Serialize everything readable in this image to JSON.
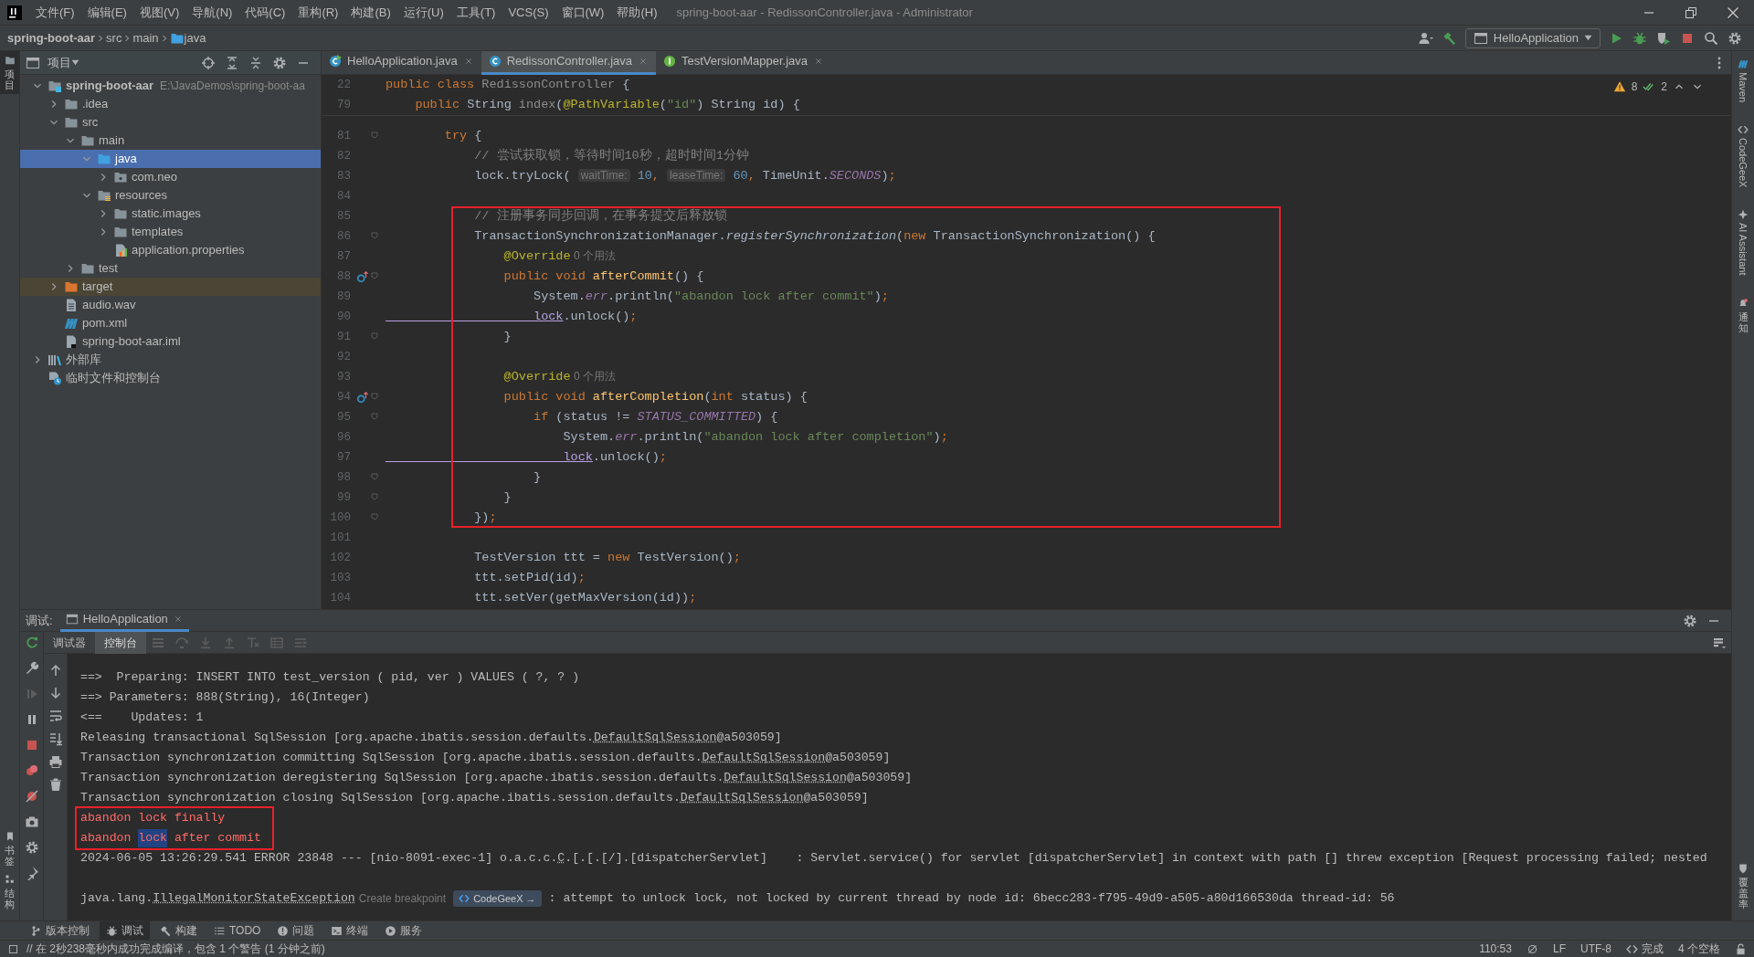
{
  "window": {
    "title": "spring-boot-aar - RedissonController.java - Administrator",
    "menu": [
      "文件(F)",
      "编辑(E)",
      "视图(V)",
      "导航(N)",
      "代码(C)",
      "重构(R)",
      "构建(B)",
      "运行(U)",
      "工具(T)",
      "VCS(S)",
      "窗口(W)",
      "帮助(H)"
    ]
  },
  "breadcrumbs": [
    {
      "label": "spring-boot-aar",
      "kind": "project"
    },
    {
      "label": "src",
      "kind": "dir"
    },
    {
      "label": "main",
      "kind": "dir"
    },
    {
      "label": "java",
      "kind": "source"
    }
  ],
  "run_config": {
    "label": "HelloApplication"
  },
  "left_stripe": {
    "top": [
      {
        "label": "项目",
        "selected": true
      }
    ],
    "bottom": [
      {
        "label": "书签",
        "selected": false
      },
      {
        "label": "结构",
        "selected": false
      }
    ]
  },
  "right_stripe": {
    "top": [
      {
        "label": "Maven",
        "kind": "maven"
      },
      {
        "label": "CodeGeeX",
        "kind": "codegeex"
      },
      {
        "label": "AI Assistant",
        "kind": "ai"
      },
      {
        "label": "通知",
        "kind": "bell"
      }
    ],
    "bottom": [
      {
        "label": "覆盖率",
        "kind": "shield"
      }
    ]
  },
  "project_panel": {
    "title": "项目",
    "tree": [
      {
        "label": "spring-boot-aar",
        "note": "E:\\JavaDemos\\spring-boot-aa",
        "kind": "module",
        "expanded": true,
        "selected": false,
        "children": [
          {
            "label": ".idea",
            "kind": "folder",
            "expanded": false,
            "selected": false
          },
          {
            "label": "src",
            "kind": "folder",
            "expanded": true,
            "selected": false,
            "children": [
              {
                "label": "main",
                "kind": "folder",
                "expanded": true,
                "selected": false,
                "children": [
                  {
                    "label": "java",
                    "kind": "source",
                    "expanded": true,
                    "selected": true,
                    "children": [
                      {
                        "label": "com.neo",
                        "kind": "package",
                        "expanded": false,
                        "selected": false
                      }
                    ]
                  },
                  {
                    "label": "resources",
                    "kind": "resources",
                    "expanded": true,
                    "selected": false,
                    "children": [
                      {
                        "label": "static.images",
                        "kind": "folder",
                        "expanded": false,
                        "selected": false
                      },
                      {
                        "label": "templates",
                        "kind": "folder",
                        "expanded": false,
                        "selected": false
                      },
                      {
                        "label": "application.properties",
                        "kind": "props",
                        "selected": false
                      }
                    ]
                  }
                ]
              },
              {
                "label": "test",
                "kind": "folder",
                "expanded": false,
                "selected": false
              }
            ]
          },
          {
            "label": "target",
            "kind": "excluded",
            "expanded": false,
            "selected": false
          },
          {
            "label": "audio.wav",
            "kind": "doc",
            "selected": false
          },
          {
            "label": "pom.xml",
            "kind": "maven",
            "selected": false
          },
          {
            "label": "spring-boot-aar.iml",
            "kind": "iml",
            "selected": false
          }
        ]
      },
      {
        "label": "外部库",
        "kind": "libs",
        "expanded": false,
        "selected": false
      },
      {
        "label": "临时文件和控制台",
        "kind": "scratch",
        "selected": false
      }
    ]
  },
  "editor": {
    "tabs": [
      {
        "label": "HelloApplication.java",
        "kind": "runnable",
        "selected": false
      },
      {
        "label": "RedissonController.java",
        "kind": "class",
        "selected": true
      },
      {
        "label": "TestVersionMapper.java",
        "kind": "interface",
        "selected": false
      }
    ],
    "inspections": {
      "warnings": "8",
      "checks": "2"
    },
    "sticky_lines": [
      {
        "number": "22",
        "tokens": [
          {
            "text": "public class ",
            "kind": "kw"
          },
          {
            "text": "RedissonController",
            "kind": "dim"
          },
          {
            "text": " {",
            "kind": "plain"
          }
        ]
      },
      {
        "number": "79",
        "tokens": [
          {
            "text": "    public ",
            "kind": "kw"
          },
          {
            "text": "String ",
            "kind": "plain"
          },
          {
            "text": "index",
            "kind": "dim"
          },
          {
            "text": "(",
            "kind": "plain"
          },
          {
            "text": "@PathVariable",
            "kind": "anno"
          },
          {
            "text": "(",
            "kind": "plain"
          },
          {
            "text": "\"id\"",
            "kind": "str"
          },
          {
            "text": ") String id) {",
            "kind": "plain"
          }
        ]
      }
    ],
    "lines": [
      {
        "number": "81",
        "fold": true,
        "override": false,
        "boxed": false,
        "tokens": [
          {
            "text": "        try",
            "kind": "kw"
          },
          {
            "text": " {",
            "kind": "plain"
          }
        ]
      },
      {
        "number": "82",
        "fold": false,
        "override": false,
        "boxed": false,
        "tokens": [
          {
            "text": "            // 尝试获取锁，等待时间10秒，超时时间1分钟",
            "kind": "cmt"
          }
        ]
      },
      {
        "number": "83",
        "fold": false,
        "override": false,
        "boxed": false,
        "tokens": [
          {
            "text": "            lock.tryLock( ",
            "kind": "plain"
          },
          {
            "text": "waitTime:",
            "kind": "hint"
          },
          {
            "text": " 10",
            "kind": "num"
          },
          {
            "text": ", ",
            "kind": "kw"
          },
          {
            "text": "leaseTime:",
            "kind": "hint"
          },
          {
            "text": " 60",
            "kind": "num"
          },
          {
            "text": ", ",
            "kind": "kw"
          },
          {
            "text": "TimeUnit.",
            "kind": "plain"
          },
          {
            "text": "SECONDS",
            "kind": "const"
          },
          {
            "text": ")",
            "kind": "plain"
          },
          {
            "text": ";",
            "kind": "kw"
          }
        ]
      },
      {
        "number": "84",
        "fold": false,
        "override": false,
        "boxed": false
      },
      {
        "number": "85",
        "fold": false,
        "override": false,
        "boxed": true,
        "tokens": [
          {
            "text": "            // 注册事务同步回调，在事务提交后释放锁",
            "kind": "cmt"
          }
        ]
      },
      {
        "number": "86",
        "fold": true,
        "override": false,
        "boxed": true,
        "tokens": [
          {
            "text": "            TransactionSynchronizationManager.",
            "kind": "plain"
          },
          {
            "text": "registerSynchronization",
            "kind": "it"
          },
          {
            "text": "(",
            "kind": "plain"
          },
          {
            "text": "new ",
            "kind": "kw"
          },
          {
            "text": "TransactionSynchronization() {",
            "kind": "plain"
          }
        ]
      },
      {
        "number": "87",
        "fold": false,
        "override": false,
        "boxed": true,
        "tokens": [
          {
            "text": "                @Override",
            "kind": "anno"
          },
          {
            "text": " 0 个用法",
            "kind": "usage"
          }
        ]
      },
      {
        "number": "88",
        "fold": true,
        "override": true,
        "boxed": true,
        "tokens": [
          {
            "text": "                public void ",
            "kind": "kw"
          },
          {
            "text": "afterCommit",
            "kind": "fn"
          },
          {
            "text": "() {",
            "kind": "plain"
          }
        ]
      },
      {
        "number": "89",
        "fold": false,
        "override": false,
        "boxed": true,
        "tokens": [
          {
            "text": "                    System.",
            "kind": "plain"
          },
          {
            "text": "err",
            "kind": "const"
          },
          {
            "text": ".println(",
            "kind": "plain"
          },
          {
            "text": "\"abandon lock after commit\"",
            "kind": "str"
          },
          {
            "text": ")",
            "kind": "plain"
          },
          {
            "text": ";",
            "kind": "kw"
          }
        ]
      },
      {
        "number": "90",
        "fold": false,
        "override": false,
        "boxed": true,
        "tokens": [
          {
            "text": "                    lock",
            "kind": "var"
          },
          {
            "text": ".unlock()",
            "kind": "plain"
          },
          {
            "text": ";",
            "kind": "kw"
          }
        ]
      },
      {
        "number": "91",
        "fold": true,
        "override": false,
        "boxed": true,
        "tokens": [
          {
            "text": "                }",
            "kind": "plain"
          }
        ]
      },
      {
        "number": "92",
        "fold": false,
        "override": false,
        "boxed": true
      },
      {
        "number": "93",
        "fold": false,
        "override": false,
        "boxed": true,
        "tokens": [
          {
            "text": "                @Override",
            "kind": "anno"
          },
          {
            "text": " 0 个用法",
            "kind": "usage"
          }
        ]
      },
      {
        "number": "94",
        "fold": true,
        "override": true,
        "boxed": true,
        "tokens": [
          {
            "text": "                public void ",
            "kind": "kw"
          },
          {
            "text": "afterCompletion",
            "kind": "fn"
          },
          {
            "text": "(",
            "kind": "plain"
          },
          {
            "text": "int ",
            "kind": "kw"
          },
          {
            "text": "status) {",
            "kind": "plain"
          }
        ]
      },
      {
        "number": "95",
        "fold": true,
        "override": false,
        "boxed": true,
        "tokens": [
          {
            "text": "                    if ",
            "kind": "kw"
          },
          {
            "text": "(status != ",
            "kind": "plain"
          },
          {
            "text": "STATUS_COMMITTED",
            "kind": "const"
          },
          {
            "text": ") {",
            "kind": "plain"
          }
        ]
      },
      {
        "number": "96",
        "fold": false,
        "override": false,
        "boxed": true,
        "tokens": [
          {
            "text": "                        System.",
            "kind": "plain"
          },
          {
            "text": "err",
            "kind": "const"
          },
          {
            "text": ".println(",
            "kind": "plain"
          },
          {
            "text": "\"abandon lock after completion\"",
            "kind": "str"
          },
          {
            "text": ")",
            "kind": "plain"
          },
          {
            "text": ";",
            "kind": "kw"
          }
        ]
      },
      {
        "number": "97",
        "fold": false,
        "override": false,
        "boxed": true,
        "tokens": [
          {
            "text": "                        lock",
            "kind": "var"
          },
          {
            "text": ".unlock()",
            "kind": "plain"
          },
          {
            "text": ";",
            "kind": "kw"
          }
        ]
      },
      {
        "number": "98",
        "fold": true,
        "override": false,
        "boxed": true,
        "tokens": [
          {
            "text": "                    }",
            "kind": "plain"
          }
        ]
      },
      {
        "number": "99",
        "fold": true,
        "override": false,
        "boxed": true,
        "tokens": [
          {
            "text": "                }",
            "kind": "plain"
          }
        ]
      },
      {
        "number": "100",
        "fold": true,
        "override": false,
        "boxed": true,
        "tokens": [
          {
            "text": "            })",
            "kind": "plain"
          },
          {
            "text": ";",
            "kind": "kw"
          }
        ]
      },
      {
        "number": "101",
        "fold": false,
        "override": false,
        "boxed": false
      },
      {
        "number": "102",
        "fold": false,
        "override": false,
        "boxed": false,
        "tokens": [
          {
            "text": "            TestVersion ttt = ",
            "kind": "plain"
          },
          {
            "text": "new ",
            "kind": "kw"
          },
          {
            "text": "TestVersion()",
            "kind": "plain"
          },
          {
            "text": ";",
            "kind": "kw"
          }
        ]
      },
      {
        "number": "103",
        "fold": false,
        "override": false,
        "boxed": false,
        "tokens": [
          {
            "text": "            ttt.setPid(id)",
            "kind": "plain"
          },
          {
            "text": ";",
            "kind": "kw"
          }
        ]
      },
      {
        "number": "104",
        "fold": false,
        "override": false,
        "boxed": false,
        "tokens": [
          {
            "text": "            ttt.setVer(getMaxVersion(id))",
            "kind": "plain"
          },
          {
            "text": ";",
            "kind": "kw"
          }
        ]
      }
    ]
  },
  "debug_panel": {
    "label": "调试:",
    "session": "HelloApplication",
    "tabs": [
      {
        "label": "调试器",
        "selected": false
      },
      {
        "label": "控制台",
        "selected": true
      }
    ],
    "console": [
      {
        "kind": "out",
        "boxed": false,
        "tokens": [
          {
            "text": "==>  Preparing: INSERT INTO test_version ( pid, ver ) VALUES ( ?, ? )",
            "kind": "plain"
          }
        ]
      },
      {
        "kind": "out",
        "boxed": false,
        "tokens": [
          {
            "text": "==> Parameters: 888(String), 16(Integer)",
            "kind": "plain"
          }
        ]
      },
      {
        "kind": "out",
        "boxed": false,
        "tokens": [
          {
            "text": "<==    Updates: 1",
            "kind": "plain"
          }
        ]
      },
      {
        "kind": "out",
        "boxed": false,
        "tokens": [
          {
            "text": "Releasing transactional SqlSession [org.apache.ibatis.session.defaults.",
            "kind": "plain"
          },
          {
            "text": "DefaultSqlSession",
            "kind": "link"
          },
          {
            "text": "@a503059]",
            "kind": "plain"
          }
        ]
      },
      {
        "kind": "out",
        "boxed": false,
        "tokens": [
          {
            "text": "Transaction synchronization committing SqlSession [org.apache.ibatis.session.defaults.",
            "kind": "plain"
          },
          {
            "text": "DefaultSqlSession",
            "kind": "link"
          },
          {
            "text": "@a503059]",
            "kind": "plain"
          }
        ]
      },
      {
        "kind": "out",
        "boxed": false,
        "tokens": [
          {
            "text": "Transaction synchronization deregistering SqlSession [org.apache.ibatis.session.defaults.",
            "kind": "plain"
          },
          {
            "text": "DefaultSqlSession",
            "kind": "link"
          },
          {
            "text": "@a503059]",
            "kind": "plain"
          }
        ]
      },
      {
        "kind": "out",
        "boxed": false,
        "tokens": [
          {
            "text": "Transaction synchronization closing SqlSession [org.apache.ibatis.session.defaults.",
            "kind": "plain"
          },
          {
            "text": "DefaultSqlSession",
            "kind": "link"
          },
          {
            "text": "@a503059]",
            "kind": "plain"
          }
        ]
      },
      {
        "kind": "err",
        "boxed": true,
        "tokens": [
          {
            "text": "abandon lock finally",
            "kind": "plain"
          }
        ]
      },
      {
        "kind": "err",
        "boxed": true,
        "tokens": [
          {
            "text": "abandon ",
            "kind": "plain"
          },
          {
            "text": "lock",
            "kind": "sel"
          },
          {
            "text": " after commit",
            "kind": "plain"
          }
        ]
      },
      {
        "kind": "out",
        "boxed": false,
        "tokens": [
          {
            "text": "2024-06-05 13:26:29.541 ERROR 23848 --- [nio-8091-exec-1] o.a.c.c.",
            "kind": "plain"
          },
          {
            "text": "C",
            "kind": "link"
          },
          {
            "text": ".[.[.[/].[dispatcherServlet]    : Servlet.service() for servlet [dispatcherServlet] in context with path [] threw exception [Request processing failed; nested",
            "kind": "plain"
          }
        ]
      },
      {
        "kind": "out",
        "boxed": false
      },
      {
        "kind": "out",
        "boxed": false,
        "tokens": [
          {
            "text": "java.lang.",
            "kind": "plain"
          },
          {
            "text": "IllegalMonitorStateException",
            "kind": "link"
          },
          {
            "text": "Create breakpoint",
            "kind": "hint"
          },
          {
            "text": "CodeGeeX →",
            "kind": "badge"
          },
          {
            "text": ": attempt to unlock lock, not locked by current thread by node id: 6becc283-f795-49d9-a505-a80d166530da thread-id: 56",
            "kind": "plain"
          }
        ]
      }
    ]
  },
  "tool_buttons": [
    {
      "label": "版本控制",
      "kind": "vcs",
      "selected": false
    },
    {
      "label": "调试",
      "kind": "debug",
      "selected": true
    },
    {
      "label": "构建",
      "kind": "build",
      "selected": false
    },
    {
      "label": "TODO",
      "kind": "todo",
      "selected": false
    },
    {
      "label": "问题",
      "kind": "problems",
      "selected": false
    },
    {
      "label": "终端",
      "kind": "terminal",
      "selected": false
    },
    {
      "label": "服务",
      "kind": "services",
      "selected": false
    }
  ],
  "status_bar": {
    "message": "// 在 2秒238毫秒内成功完成编译，包含 1 个警告 (1 分钟之前)",
    "position": "110:53",
    "line_separator": "LF",
    "encoding": "UTF-8",
    "assistant": "完成",
    "indent": "4 个空格"
  }
}
